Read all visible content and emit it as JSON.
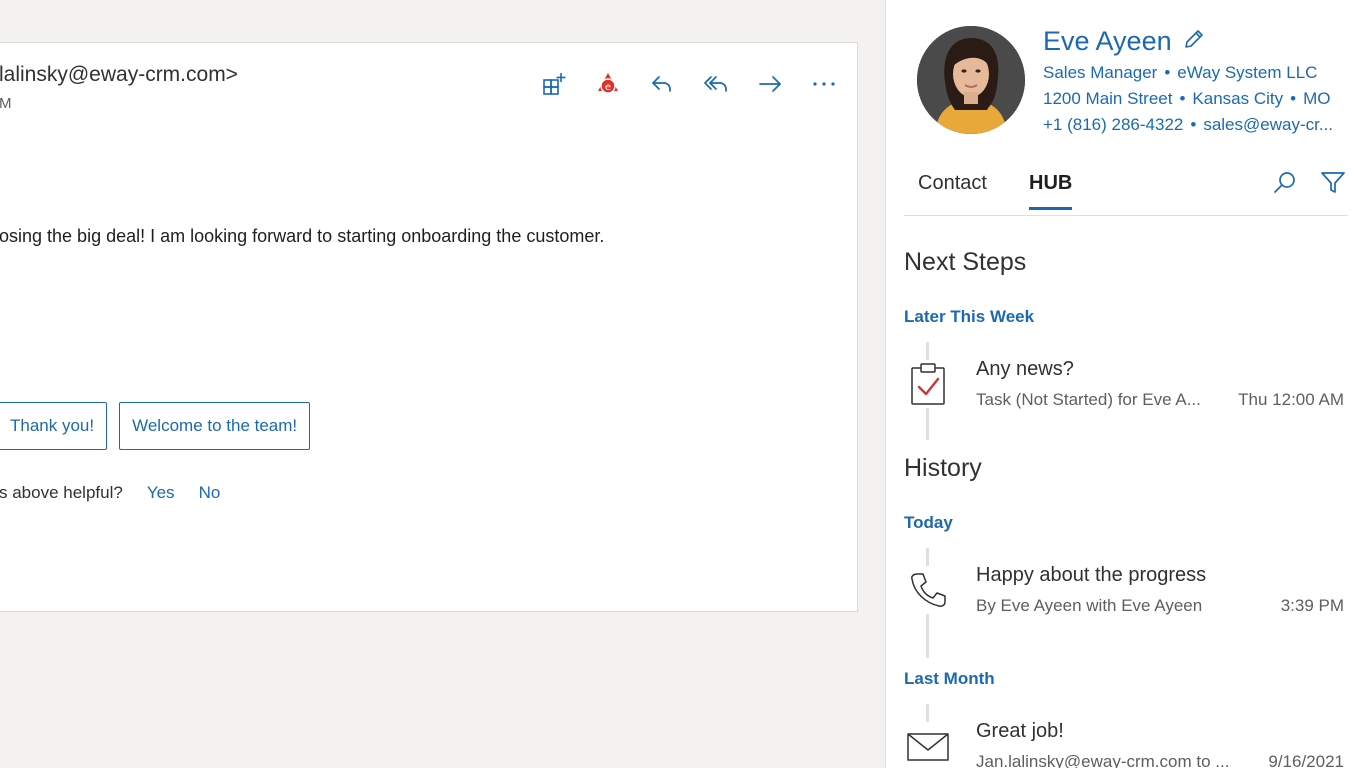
{
  "email": {
    "from": "lalinsky@eway-crm.com>",
    "time": "M",
    "body": "osing the big deal! I am looking forward to starting onboarding the customer.",
    "suggested_replies": [
      "Thank you!",
      "Welcome to the team!"
    ],
    "helpful_question": "s above helpful?",
    "helpful_yes": "Yes",
    "helpful_no": "No",
    "toolbar_icons": [
      "apps-add-icon",
      "eway-icon",
      "reply-icon",
      "reply-all-icon",
      "forward-icon",
      "more-icon"
    ]
  },
  "contact": {
    "name": "Eve Ayeen",
    "title": "Sales Manager",
    "company": "eWay System LLC",
    "street": "1200 Main Street",
    "city": "Kansas City",
    "state": "MO",
    "phone": "+1 (816) 286-4322",
    "email": "sales@eway-cr...",
    "separator": "•"
  },
  "tabs": {
    "contact": "Contact",
    "hub": "HUB",
    "active": "HUB"
  },
  "next_steps": {
    "title": "Next Steps",
    "group": "Later This Week",
    "item": {
      "icon": "task-clipboard-icon",
      "title": "Any news?",
      "subtitle": "Task (Not Started) for Eve A...",
      "date": "Thu 12:00 AM"
    }
  },
  "history": {
    "title": "History",
    "groups": [
      {
        "label": "Today",
        "item": {
          "icon": "phone-icon",
          "title": "Happy about the progress",
          "subtitle": "By Eve Ayeen with Eve Ayeen",
          "date": "3:39 PM"
        }
      },
      {
        "label": "Last Month",
        "item": {
          "icon": "envelope-icon",
          "title": "Great job!",
          "subtitle": "Jan.lalinsky@eway-crm.com to ...",
          "date": "9/16/2021"
        }
      }
    ]
  },
  "colors": {
    "accent": "#1b6ab1",
    "eway_red": "#e0302b",
    "task_check": "#d13438"
  }
}
